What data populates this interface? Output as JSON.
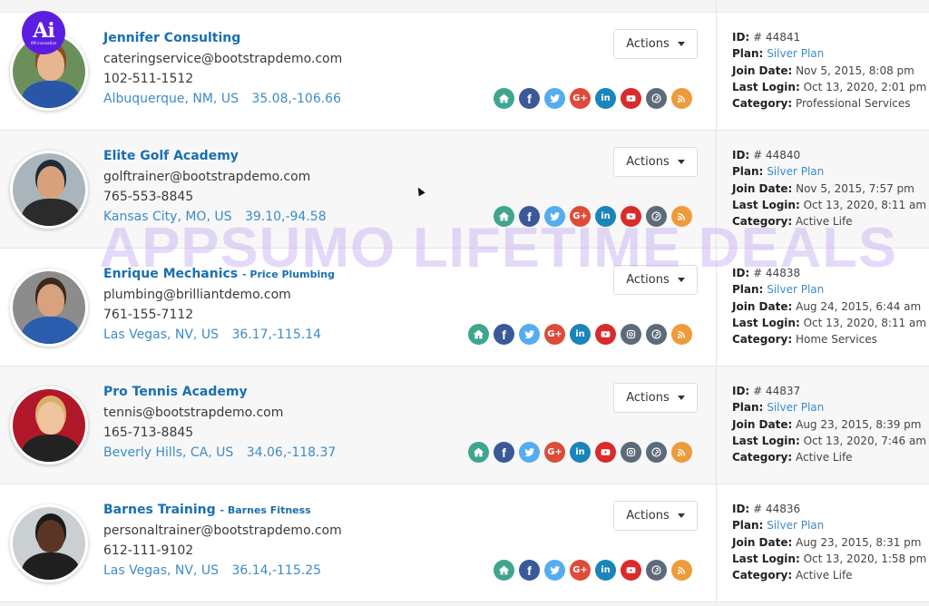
{
  "branding": {
    "logo_text": "Ai",
    "logo_subtext": "APi innovation",
    "watermark": "APPSUMO LIFETIME DEALS"
  },
  "colors": {
    "link": "#1a6fb0",
    "location": "#3b8cc8",
    "logo_bg": "#5b1ee0",
    "home": "#3fa58f",
    "facebook": "#3b5998",
    "twitter": "#55acee",
    "googleplus": "#dd4b39",
    "linkedin": "#1a84bc",
    "youtube": "#d92b2b",
    "instagram": "#5d6b78",
    "pinterest": "#5d6b78",
    "rss": "#ee9b3b"
  },
  "labels": {
    "actions": "Actions",
    "id": "ID:",
    "plan": "Plan:",
    "join_date": "Join Date:",
    "last_login": "Last Login:",
    "category": "Category:"
  },
  "members": [
    {
      "name": "Jennifer Consulting",
      "subtitle": "",
      "email": "cateringservice@bootstrapdemo.com",
      "phone": "102-511-1512",
      "location": "Albuquerque, NM, US",
      "coords": "35.08,-106.66",
      "id": "# 44841",
      "plan": "Silver Plan",
      "join_date": "Nov 5, 2015, 8:08 pm",
      "last_login": "Oct 13, 2020, 2:01 pm",
      "category": "Professional Services",
      "socials": [
        "home",
        "facebook",
        "twitter",
        "googleplus",
        "linkedin",
        "youtube",
        "pinterest",
        "rss"
      ]
    },
    {
      "name": "Elite Golf Academy",
      "subtitle": "",
      "email": "golftrainer@bootstrapdemo.com",
      "phone": "765-553-8845",
      "location": "Kansas City, MO, US",
      "coords": "39.10,-94.58",
      "id": "# 44840",
      "plan": "Silver Plan",
      "join_date": "Nov 5, 2015, 7:57 pm",
      "last_login": "Oct 13, 2020, 8:11 am",
      "category": "Active Life",
      "socials": [
        "home",
        "facebook",
        "twitter",
        "googleplus",
        "linkedin",
        "youtube",
        "pinterest",
        "rss"
      ]
    },
    {
      "name": "Enrique Mechanics",
      "subtitle": "- Price Plumbing",
      "email": "plumbing@brilliantdemo.com",
      "phone": "761-155-7112",
      "location": "Las Vegas, NV, US",
      "coords": "36.17,-115.14",
      "id": "# 44838",
      "plan": "Silver Plan",
      "join_date": "Aug 24, 2015, 6:44 am",
      "last_login": "Oct 13, 2020, 8:11 am",
      "category": "Home Services",
      "socials": [
        "home",
        "facebook",
        "twitter",
        "googleplus",
        "linkedin",
        "youtube",
        "instagram",
        "pinterest",
        "rss"
      ]
    },
    {
      "name": "Pro Tennis Academy",
      "subtitle": "",
      "email": "tennis@bootstrapdemo.com",
      "phone": "165-713-8845",
      "location": "Beverly Hills, CA, US",
      "coords": "34.06,-118.37",
      "id": "# 44837",
      "plan": "Silver Plan",
      "join_date": "Aug 23, 2015, 8:39 pm",
      "last_login": "Oct 13, 2020, 7:46 am",
      "category": "Active Life",
      "socials": [
        "home",
        "facebook",
        "twitter",
        "googleplus",
        "linkedin",
        "youtube",
        "instagram",
        "pinterest",
        "rss"
      ]
    },
    {
      "name": "Barnes Training",
      "subtitle": "- Barnes Fitness",
      "email": "personaltrainer@bootstrapdemo.com",
      "phone": "612-111-9102",
      "location": "Las Vegas, NV, US",
      "coords": "36.14,-115.25",
      "id": "# 44836",
      "plan": "Silver Plan",
      "join_date": "Aug 23, 2015, 8:31 pm",
      "last_login": "Oct 13, 2020, 1:58 pm",
      "category": "Active Life",
      "socials": [
        "home",
        "facebook",
        "twitter",
        "googleplus",
        "linkedin",
        "youtube",
        "pinterest",
        "rss"
      ]
    }
  ]
}
